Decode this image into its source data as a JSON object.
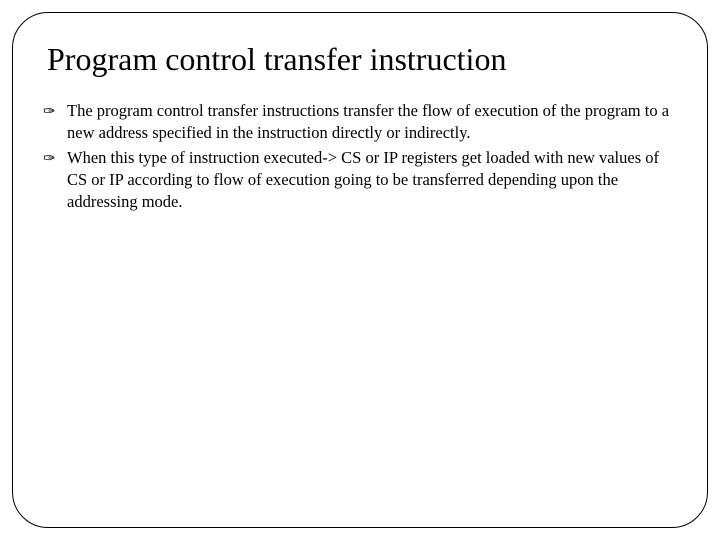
{
  "slide": {
    "title": "Program control transfer instruction",
    "bullets": [
      {
        "icon": "✑",
        "text": "The program control transfer instructions transfer the flow of execution of the program to a new address specified in the instruction directly or indirectly."
      },
      {
        "icon": "✑",
        "text": "When this type of instruction executed-> CS or IP registers get loaded with new values of CS or IP according to flow of execution going to be transferred depending upon the addressing mode."
      }
    ]
  }
}
